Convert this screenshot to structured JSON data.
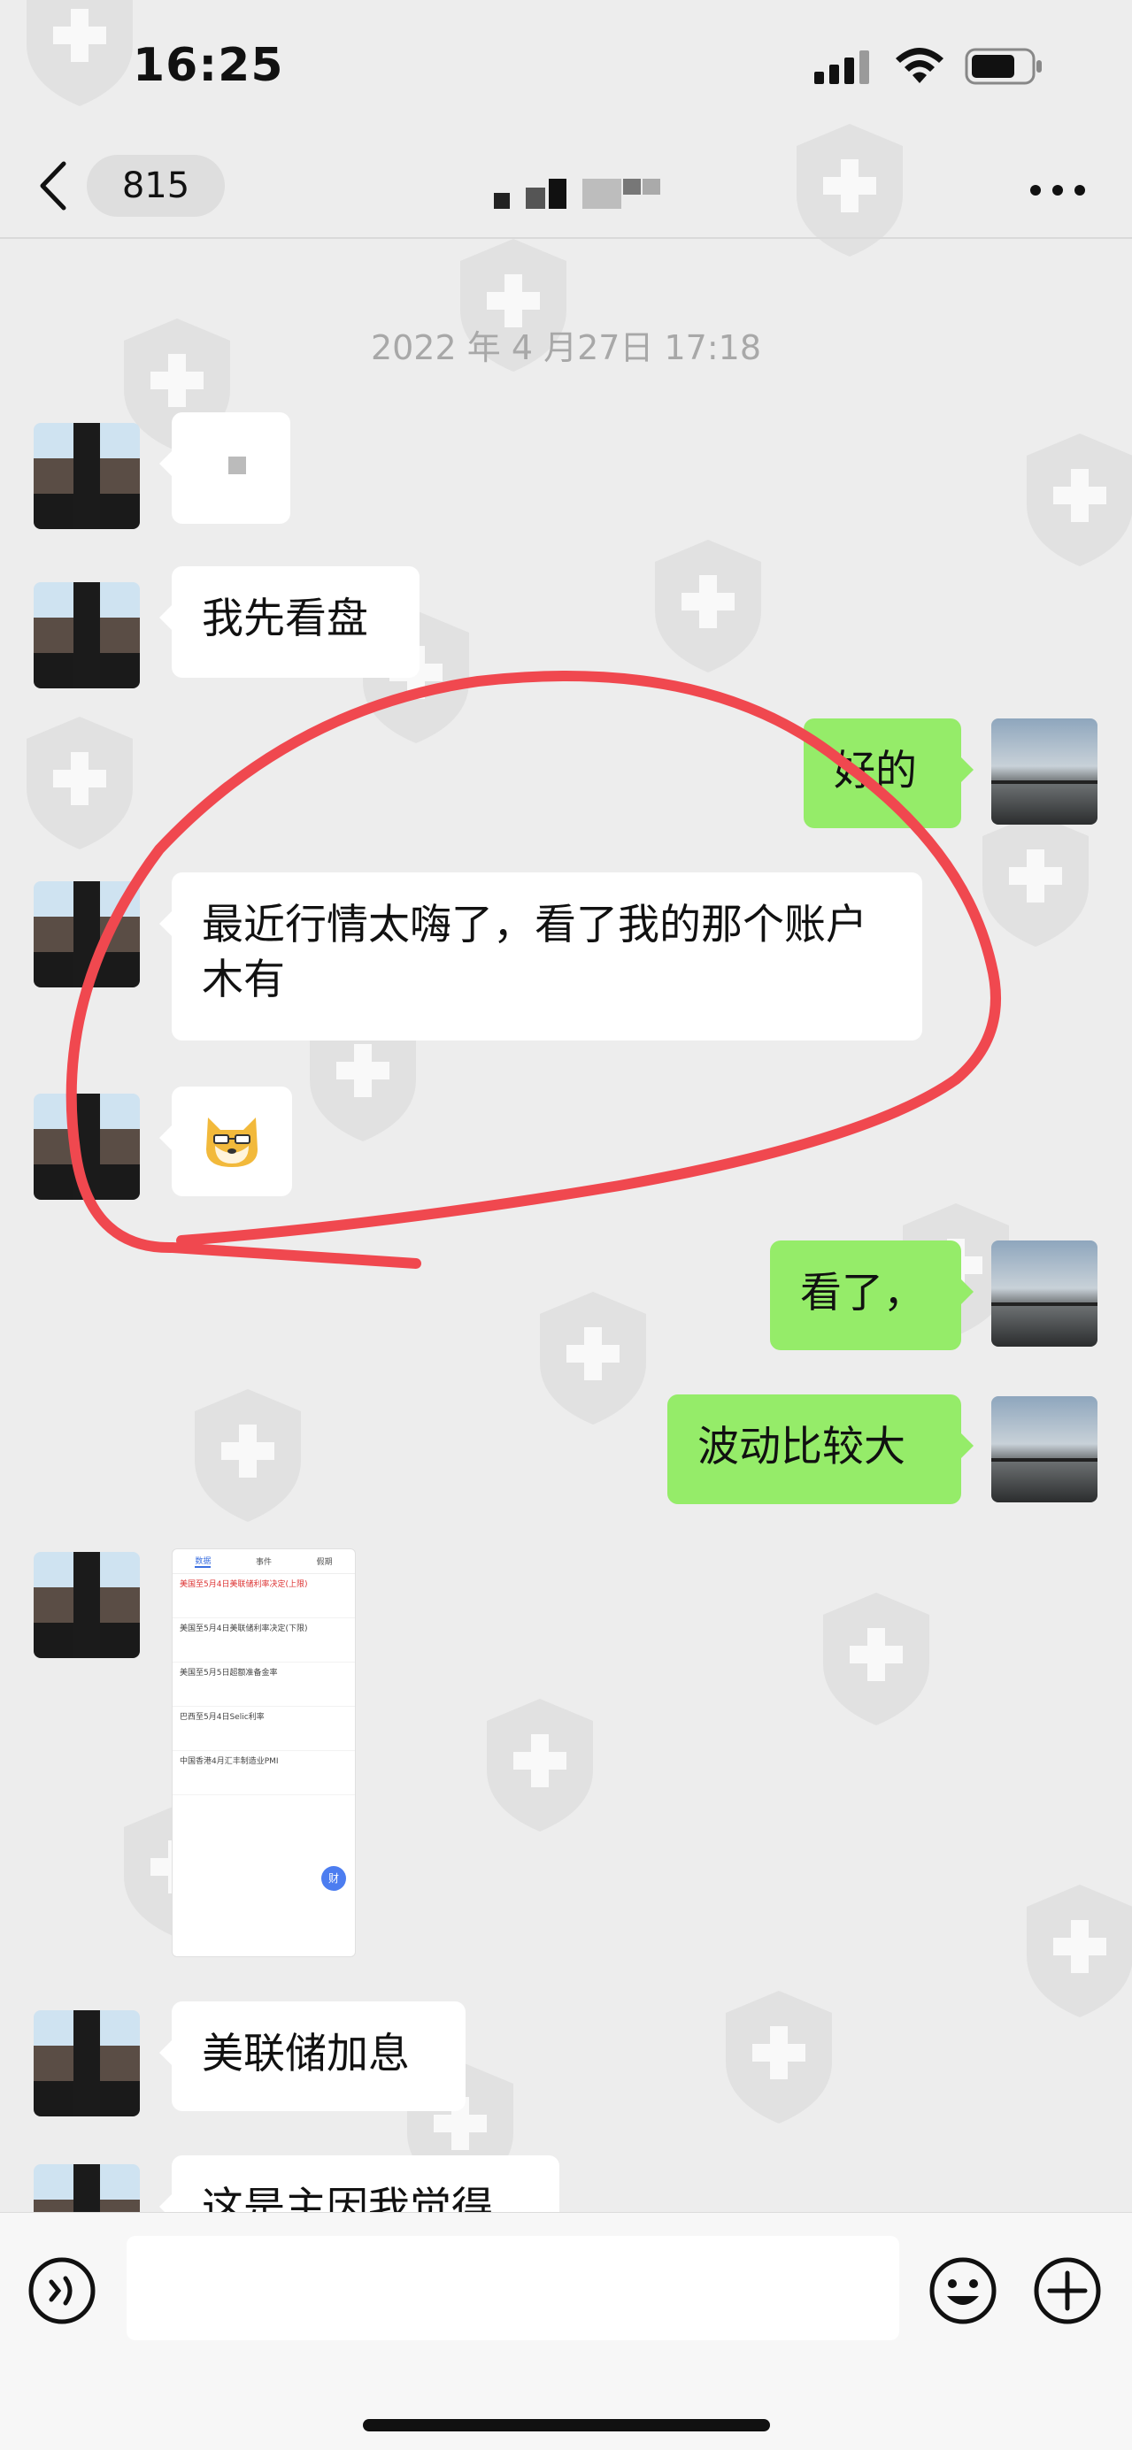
{
  "status_bar": {
    "time": "16:25"
  },
  "nav": {
    "unread_count": "815"
  },
  "chat": {
    "timestamp": "2022 年 4 月27日 17:18",
    "messages": [
      {
        "side": "in",
        "text": ""
      },
      {
        "side": "in",
        "text": "我先看盘"
      },
      {
        "side": "out",
        "text": "好的"
      },
      {
        "side": "in",
        "text": "最近行情太嗨了，看了我的那个账户木有"
      },
      {
        "side": "in",
        "text": "",
        "type": "emoji"
      },
      {
        "side": "out",
        "text": "看了，"
      },
      {
        "side": "out",
        "text": "波动比较大"
      },
      {
        "side": "in",
        "type": "image"
      },
      {
        "side": "in",
        "text": "美联储加息"
      },
      {
        "side": "in",
        "text": "这是主因我觉得"
      }
    ]
  },
  "image_preview": {
    "tabs": [
      "数据",
      "事件",
      "假期"
    ],
    "rows": [
      "美国至5月4日美联储利率决定(上限)",
      "美国至5月4日美联储利率决定(下限)",
      "美国至5月5日超额准备金率",
      "巴西至5月4日Selic利率",
      "中国香港4月汇丰制造业PMI"
    ],
    "fab": "财"
  },
  "colors": {
    "background": "#ededed",
    "outgoing_bubble": "#95ec69",
    "incoming_bubble": "#ffffff",
    "annotation": "#f0484f"
  },
  "icons": [
    "back-chevron-icon",
    "more-icon",
    "voice-icon",
    "emoji-icon",
    "plus-icon",
    "signal-icon",
    "wifi-icon",
    "battery-icon"
  ]
}
